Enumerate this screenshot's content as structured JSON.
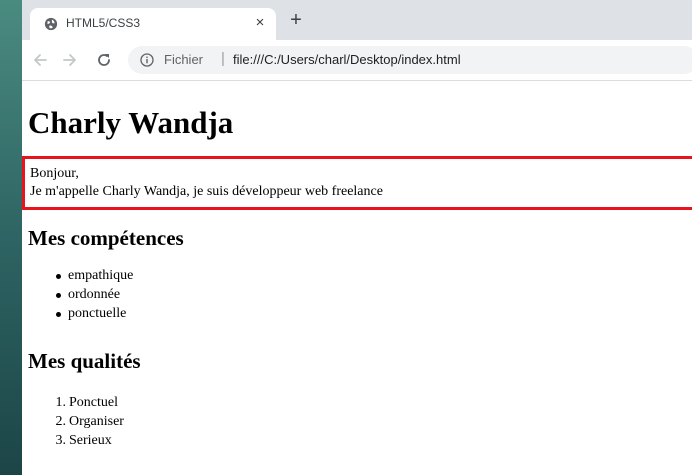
{
  "browser": {
    "tab": {
      "title": "HTML5/CSS3",
      "close_glyph": "×"
    },
    "new_tab_glyph": "+",
    "address_bar": {
      "origin_label": "Fichier",
      "separator": "|",
      "url": "file:///C:/Users/charl/Desktop/index.html"
    },
    "icons": [
      "globe-icon",
      "close-icon",
      "plus-icon",
      "back-arrow-icon",
      "forward-arrow-icon",
      "reload-icon",
      "info-icon"
    ]
  },
  "page": {
    "title": "Charly Wandja",
    "intro": {
      "line1": "Bonjour,",
      "line2": "Je m'appelle Charly Wandja, je suis développeur web freelance"
    },
    "skills": {
      "heading": "Mes compétences",
      "items": [
        "empathique",
        "ordonnée",
        "ponctuelle"
      ]
    },
    "qualities": {
      "heading": "Mes qualités",
      "items": [
        {
          "num": "1.",
          "text": "Ponctuel"
        },
        {
          "num": "2.",
          "text": "Organiser"
        },
        {
          "num": "3.",
          "text": "Serieux"
        }
      ]
    }
  },
  "colors": {
    "intro_border": "#e8141b",
    "tabstrip": "#dee1e6",
    "omnibox": "#f1f3f4"
  }
}
